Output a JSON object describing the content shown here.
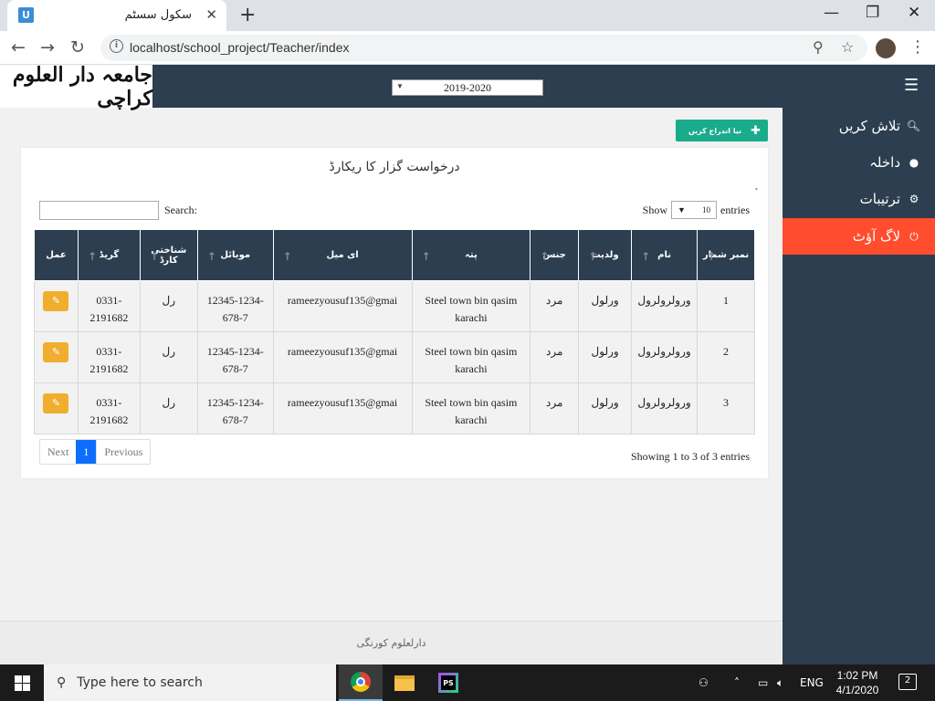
{
  "browser": {
    "tab_title": "سکول سسٹم",
    "tab_favicon": "U",
    "url": "localhost/school_project/Teacher/index",
    "icons": {
      "back": "back-arrow-icon",
      "forward": "forward-arrow-icon",
      "reload": "reload-icon",
      "zoom": "zoom-icon",
      "bookmark": "star-icon",
      "menu": "kebab-menu-icon"
    }
  },
  "header": {
    "logo_text": "جامعہ دار العلوم کراچی",
    "session_select_value": "2019-2020"
  },
  "sidebar": {
    "items": [
      {
        "label": "تلاش کریں",
        "icon": "search-icon"
      },
      {
        "label": "داخلہ",
        "icon": "user-icon"
      },
      {
        "label": "ترتیبات",
        "icon": "gear-icon"
      },
      {
        "label": "لاگ آؤٹ",
        "icon": "power-icon",
        "active": true
      }
    ],
    "active_color": "#ff4d2e"
  },
  "main": {
    "add_button_label": "نیا اندراج کریں",
    "card_title": "درخواست گزار کا ریکارڈ",
    "corner_mark": "ٔ",
    "show_label": "Show",
    "entries_label": "entries",
    "page_length_value": "10",
    "search_label": "Search:",
    "search_value": "",
    "columns": [
      "نمبر شمار",
      "نام",
      "ولدیت",
      "جنس",
      "پتہ",
      "ای میل",
      "موبائل",
      "شناختی کارڈ",
      "گریڈ",
      "عمل"
    ],
    "rows": [
      {
        "no": "1",
        "name": "ورولرولرول",
        "father": "ورلول",
        "gender": "مرد",
        "address": "Steel town bin qasim karachi",
        "email": "rameezyousuf135@gmai",
        "mobile": "12345-1234-678-7",
        "cnic": "رل",
        "grade": "0331-2191682"
      },
      {
        "no": "2",
        "name": "ورولرولرول",
        "father": "ورلول",
        "gender": "مرد",
        "address": "Steel town bin qasim karachi",
        "email": "rameezyousuf135@gmai",
        "mobile": "12345-1234-678-7",
        "cnic": "رل",
        "grade": "0331-2191682"
      },
      {
        "no": "3",
        "name": "ورولرولرول",
        "father": "ورلول",
        "gender": "مرد",
        "address": "Steel town bin qasim karachi",
        "email": "rameezyousuf135@gmai",
        "mobile": "12345-1234-678-7",
        "cnic": "رل",
        "grade": "0331-2191682"
      }
    ],
    "info_text": "Showing 1 to 3 of 3 entries",
    "pager": {
      "next": "Next",
      "current": "1",
      "previous": "Previous"
    }
  },
  "footer": {
    "text": "دارلعلوم کورنگی"
  },
  "taskbar": {
    "search_placeholder": "Type here to search",
    "language": "ENG",
    "time": "1:02 PM",
    "date": "4/1/2020",
    "notification_count": "2"
  },
  "colors": {
    "nav_dark": "#2c3e50",
    "add_button": "#1aab8a",
    "edit_button": "#f0ad2e",
    "pager_active": "#0d6efd"
  }
}
